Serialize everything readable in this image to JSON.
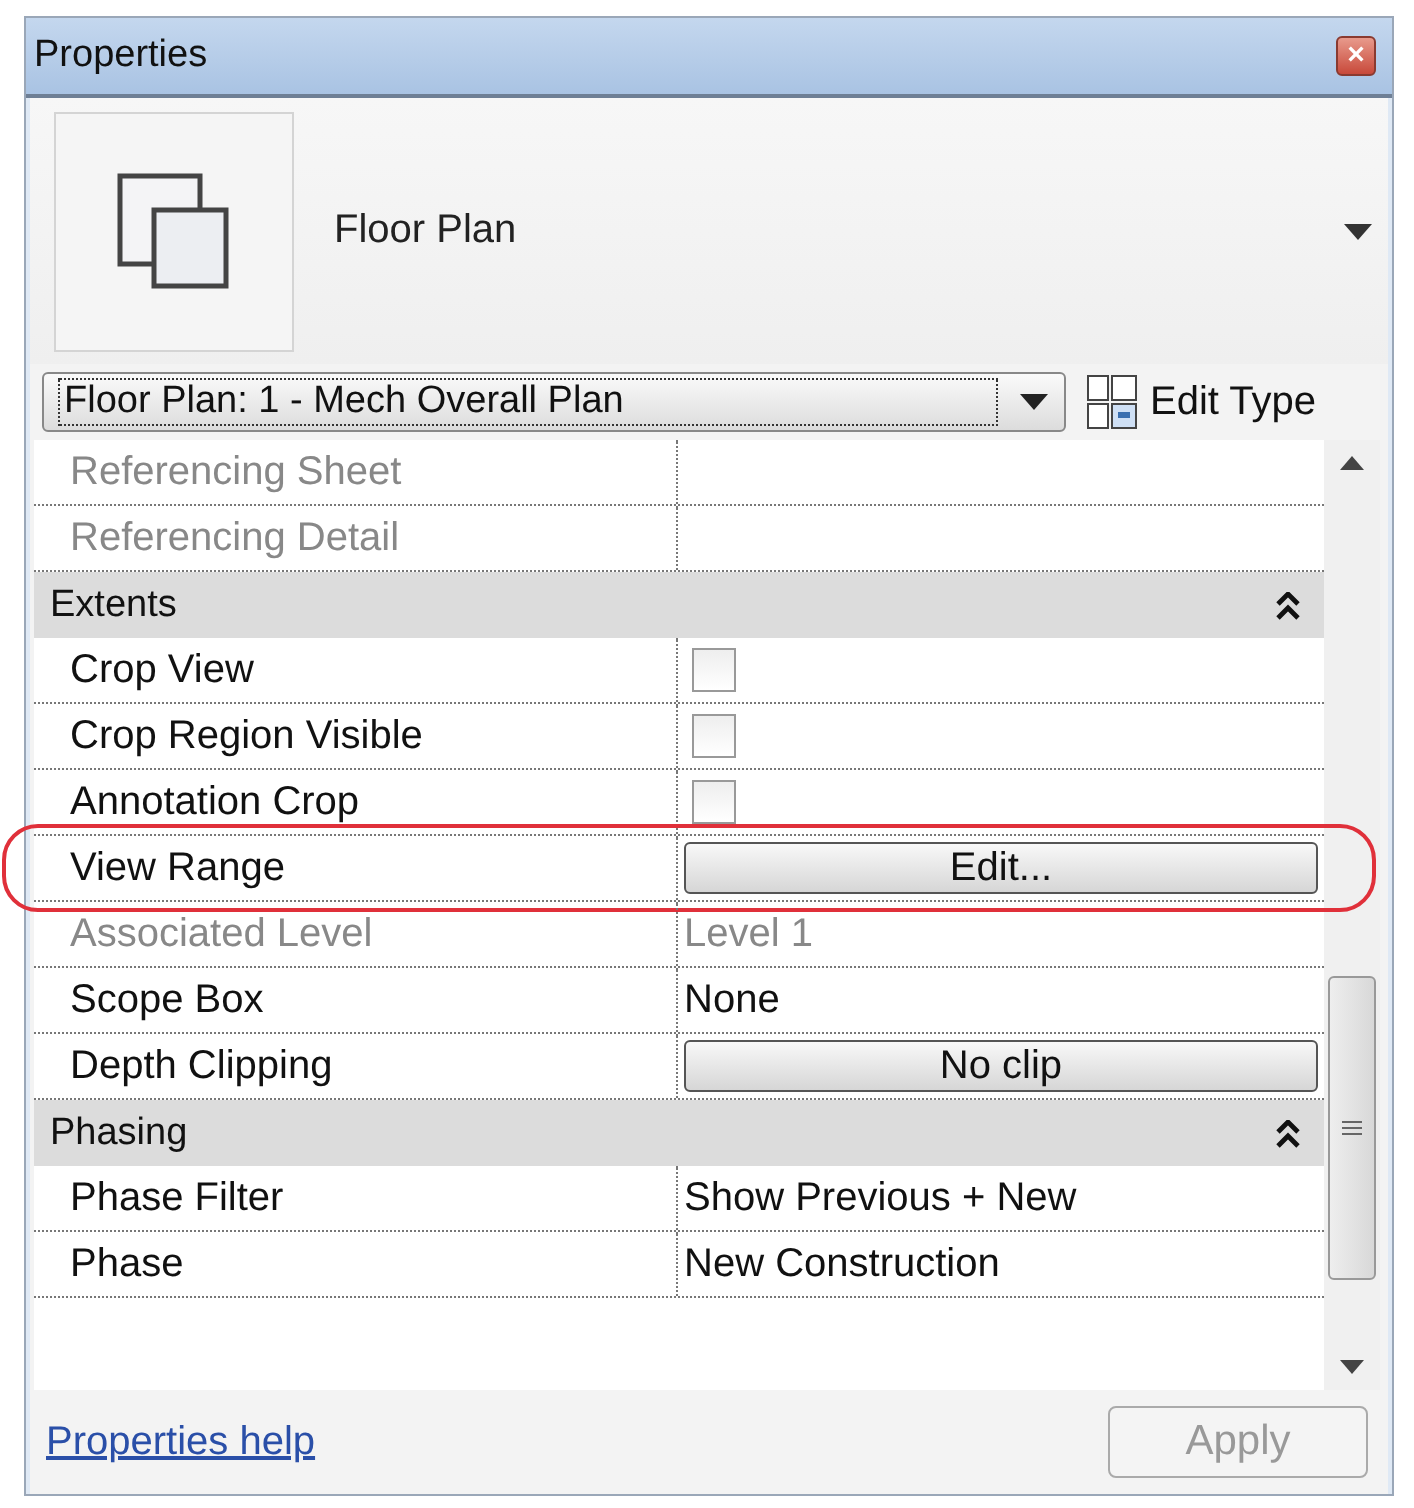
{
  "window": {
    "title": "Properties",
    "close": "×"
  },
  "type_selector": {
    "name": "Floor Plan"
  },
  "instance": {
    "value": "Floor Plan: 1 - Mech Overall Plan",
    "edit_type": "Edit Type"
  },
  "rows": [
    {
      "kind": "text",
      "label": "Referencing Sheet",
      "value": "",
      "disabled": true,
      "highlighted": false
    },
    {
      "kind": "text",
      "label": "Referencing Detail",
      "value": "",
      "disabled": true,
      "highlighted": false
    },
    {
      "kind": "group",
      "label": "Extents",
      "expanded": true
    },
    {
      "kind": "checkbox",
      "label": "Crop View",
      "checked": false,
      "disabled": false,
      "highlighted": false
    },
    {
      "kind": "checkbox",
      "label": "Crop Region Visible",
      "checked": false,
      "disabled": false,
      "highlighted": false
    },
    {
      "kind": "checkbox",
      "label": "Annotation Crop",
      "checked": false,
      "disabled": false,
      "highlighted": false
    },
    {
      "kind": "button",
      "label": "View Range",
      "value": "Edit...",
      "disabled": false,
      "highlighted": true
    },
    {
      "kind": "text",
      "label": "Associated Level",
      "value": "Level 1",
      "disabled": true,
      "highlighted": false
    },
    {
      "kind": "text",
      "label": "Scope Box",
      "value": "None",
      "disabled": false,
      "highlighted": false
    },
    {
      "kind": "button",
      "label": "Depth Clipping",
      "value": "No clip",
      "disabled": false,
      "highlighted": false
    },
    {
      "kind": "group",
      "label": "Phasing",
      "expanded": true
    },
    {
      "kind": "text",
      "label": "Phase Filter",
      "value": "Show Previous + New",
      "disabled": false,
      "highlighted": false
    },
    {
      "kind": "text",
      "label": "Phase",
      "value": "New Construction",
      "disabled": false,
      "highlighted": false
    }
  ],
  "footer": {
    "help_link": "Properties help",
    "apply": "Apply",
    "apply_disabled": true
  }
}
